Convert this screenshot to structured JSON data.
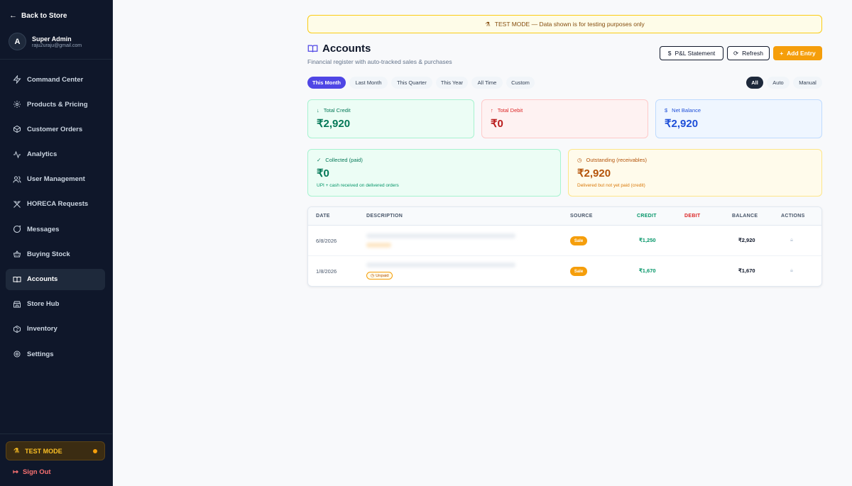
{
  "sidebar": {
    "back_label": "Back to Store",
    "user": {
      "initial": "A",
      "name": "Super Admin",
      "email": "raju2uraju@gmail.com"
    },
    "items": [
      {
        "label": "Command Center",
        "icon": "zap-icon",
        "active": false
      },
      {
        "label": "Products & Pricing",
        "icon": "gear-icon",
        "active": false
      },
      {
        "label": "Customer Orders",
        "icon": "box-icon",
        "active": false
      },
      {
        "label": "Analytics",
        "icon": "activity-icon",
        "active": false
      },
      {
        "label": "User Management",
        "icon": "users-icon",
        "active": false
      },
      {
        "label": "HORECA Requests",
        "icon": "utensils-icon",
        "active": false
      },
      {
        "label": "Messages",
        "icon": "chat-icon",
        "active": false
      },
      {
        "label": "Buying Stock",
        "icon": "basket-icon",
        "active": false
      },
      {
        "label": "Accounts",
        "icon": "book-icon",
        "active": true
      },
      {
        "label": "Store Hub",
        "icon": "store-icon",
        "active": false
      },
      {
        "label": "Inventory",
        "icon": "package-icon",
        "active": false
      },
      {
        "label": "Settings",
        "icon": "settings-icon",
        "active": false
      }
    ],
    "test_mode_label": "TEST MODE",
    "sign_out_label": "Sign Out"
  },
  "banner": {
    "text": "TEST MODE — Data shown is for testing purposes only"
  },
  "header": {
    "title": "Accounts",
    "subtitle": "Financial register with auto-tracked sales & purchases",
    "pl_label": "P&L Statement",
    "refresh_label": "Refresh",
    "add_label": "Add Entry"
  },
  "filters": {
    "periods": [
      "This Month",
      "Last Month",
      "This Quarter",
      "This Year",
      "All Time",
      "Custom"
    ],
    "active_period": "This Month",
    "types": [
      "All",
      "Auto",
      "Manual"
    ],
    "active_type": "All"
  },
  "summary": {
    "credit": {
      "label": "Total Credit",
      "value": "₹2,920"
    },
    "debit": {
      "label": "Total Debit",
      "value": "₹0"
    },
    "balance": {
      "label": "Net Balance",
      "value": "₹2,920"
    },
    "collected": {
      "label": "Collected (paid)",
      "value": "₹0",
      "note": "UPI + cash received on delivered orders"
    },
    "outstanding": {
      "label": "Outstanding (receivables)",
      "value": "₹2,920",
      "note": "Delivered but not yet paid (credit)"
    }
  },
  "table": {
    "headers": [
      "DATE",
      "DESCRIPTION",
      "SOURCE",
      "CREDIT",
      "DEBIT",
      "BALANCE",
      "ACTIONS"
    ],
    "rows": [
      {
        "date": "6/8/2026",
        "source": "Sale",
        "credit": "₹1,250",
        "debit": "",
        "balance": "₹2,920",
        "status": ""
      },
      {
        "date": "1/8/2026",
        "source": "Sale",
        "credit": "₹1,670",
        "debit": "",
        "balance": "₹1,670",
        "status": "Unpaid"
      }
    ]
  },
  "colors": {
    "accent": "#4f46e5",
    "orange": "#f59e0b",
    "credit": "#059669",
    "debit": "#dc2626",
    "net": "#1d4ed8",
    "sidebar_bg": "#0f172a"
  }
}
